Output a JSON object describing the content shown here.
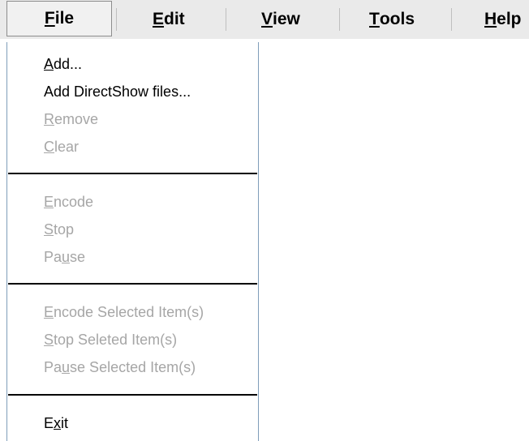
{
  "menubar": {
    "items": [
      {
        "label_pre": "",
        "mnemonic": "F",
        "label_post": "ile",
        "open": true
      },
      {
        "label_pre": "",
        "mnemonic": "E",
        "label_post": "dit"
      },
      {
        "label_pre": "",
        "mnemonic": "V",
        "label_post": "iew"
      },
      {
        "label_pre": "",
        "mnemonic": "T",
        "label_post": "ools"
      },
      {
        "label_pre": "",
        "mnemonic": "H",
        "label_post": "elp"
      }
    ]
  },
  "file_menu": {
    "items": [
      {
        "pre": "",
        "mn": "A",
        "post": "dd...",
        "enabled": true
      },
      {
        "pre": "Add DirectShow files...",
        "mn": "",
        "post": "",
        "enabled": true
      },
      {
        "pre": "",
        "mn": "R",
        "post": "emove",
        "enabled": false
      },
      {
        "pre": "",
        "mn": "C",
        "post": "lear",
        "enabled": false
      },
      {
        "pre": "",
        "mn": "E",
        "post": "ncode",
        "enabled": false
      },
      {
        "pre": "",
        "mn": "S",
        "post": "top",
        "enabled": false
      },
      {
        "pre": "Pa",
        "mn": "u",
        "post": "se",
        "enabled": false
      },
      {
        "pre": "",
        "mn": "E",
        "post": "ncode Selected Item(s)",
        "enabled": false
      },
      {
        "pre": "",
        "mn": "S",
        "post": "top Seleted Item(s)",
        "enabled": false
      },
      {
        "pre": "Pa",
        "mn": "u",
        "post": "se Selected Item(s)",
        "enabled": false
      },
      {
        "pre": "E",
        "mn": "x",
        "post": "it",
        "enabled": true
      }
    ]
  },
  "colors": {
    "menubar_bg": "#eaeaea",
    "disabled_text": "#a6a6a6",
    "menu_border": "#7f9db9"
  }
}
